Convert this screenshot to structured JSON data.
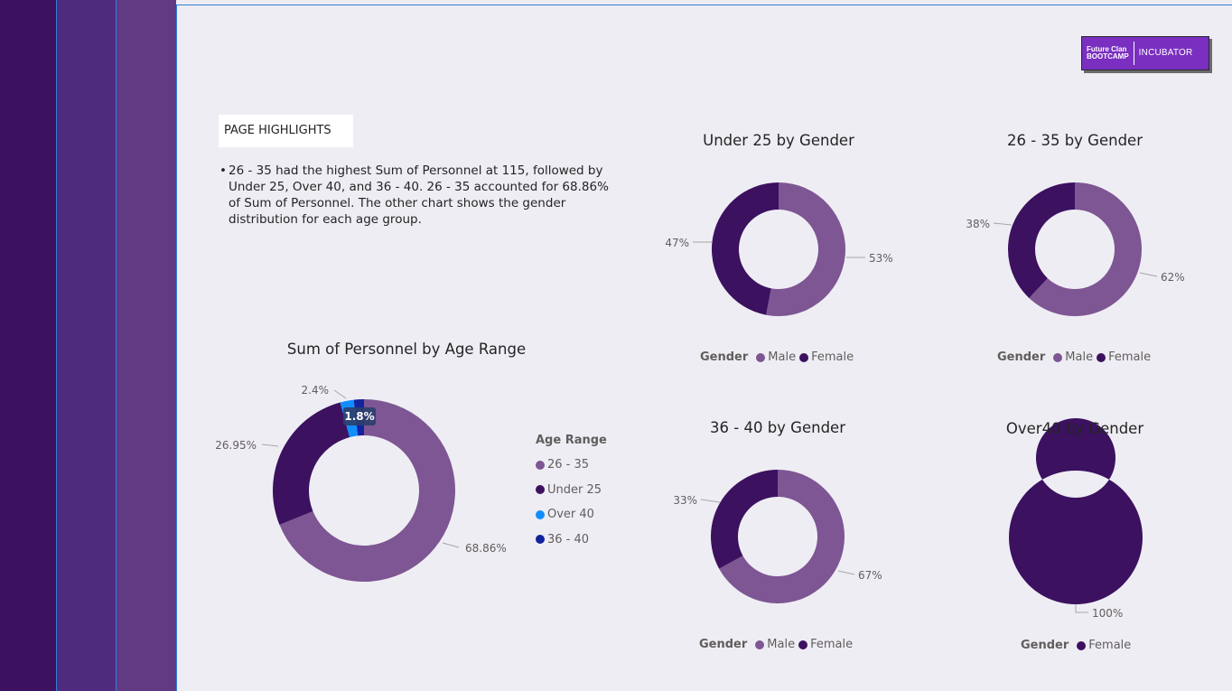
{
  "highlights": {
    "title": "PAGE HIGHLIGHTS",
    "bullet": "•",
    "text": "26 - 35 had the highest Sum of Personnel at 115, followed by Under 25, Over 40, and 36 - 40. 26 - 35 accounted for 68.86% of Sum of Personnel. The other chart shows the gender distribution for each age group."
  },
  "logo": {
    "left_line1": "Future Clan",
    "left_line2": "BOOTCAMP",
    "right_text": "INCUBATOR"
  },
  "colors": {
    "male": "#7d5693",
    "female": "#3b1160",
    "age_26_35": "#7d5693",
    "age_under_25": "#3b1160",
    "age_over_40": "#118dff",
    "age_36_40": "#12239e"
  },
  "chart_data": [
    {
      "type": "pie",
      "title": "Sum of Personnel by Age Range",
      "legend_title": "Age Range",
      "categories": [
        "26 - 35",
        "Under 25",
        "Over 40",
        "36 - 40"
      ],
      "values": [
        68.86,
        26.95,
        2.4,
        1.8
      ],
      "labels": [
        "68.86%",
        "26.95%",
        "2.4%",
        "1.8%"
      ],
      "highlight_label": "1.8%"
    },
    {
      "type": "pie",
      "title": "Under 25 by Gender",
      "legend_title": "Gender",
      "categories": [
        "Male",
        "Female"
      ],
      "values": [
        53,
        47
      ],
      "labels": [
        "53%",
        "47%"
      ]
    },
    {
      "type": "pie",
      "title": "26 - 35 by Gender",
      "legend_title": "Gender",
      "categories": [
        "Male",
        "Female"
      ],
      "values": [
        62,
        38
      ],
      "labels": [
        "62%",
        "38%"
      ]
    },
    {
      "type": "pie",
      "title": "36 - 40 by Gender",
      "legend_title": "Gender",
      "categories": [
        "Male",
        "Female"
      ],
      "values": [
        67,
        33
      ],
      "labels": [
        "67%",
        "33%"
      ]
    },
    {
      "type": "pie",
      "title": "Over40 by Gender",
      "legend_title": "Gender",
      "categories": [
        "Female"
      ],
      "values": [
        100
      ],
      "labels": [
        "100%"
      ]
    }
  ]
}
